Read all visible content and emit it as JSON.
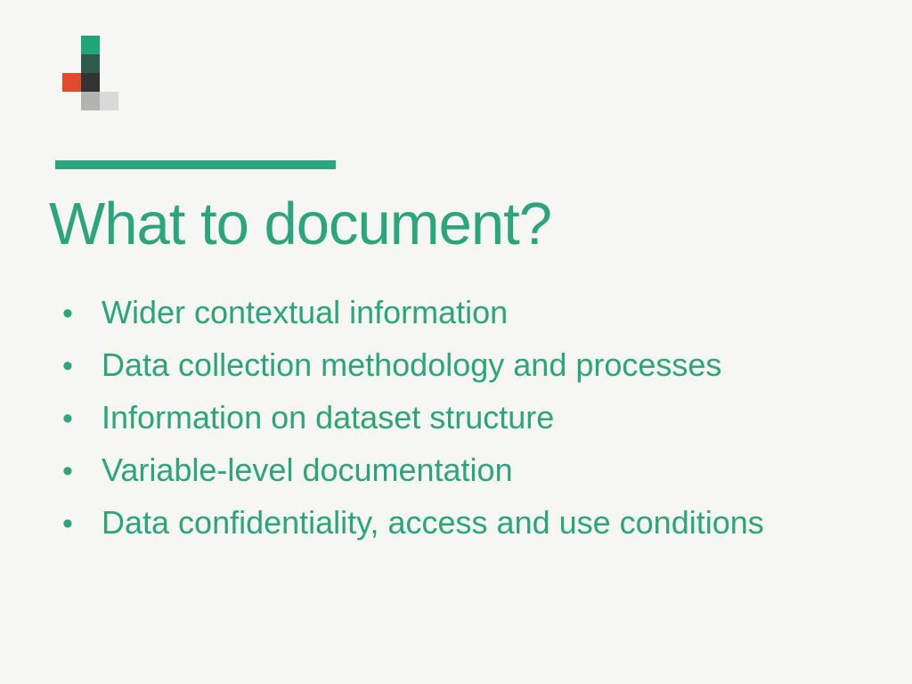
{
  "title": "What to document?",
  "colors": {
    "accent": "#2aa57e",
    "background": "#f6f6f2"
  },
  "bullets": [
    "Wider contextual information",
    "Data collection methodology and processes",
    "Information on dataset structure",
    "Variable-level documentation",
    "Data confidentiality, access and use conditions"
  ]
}
